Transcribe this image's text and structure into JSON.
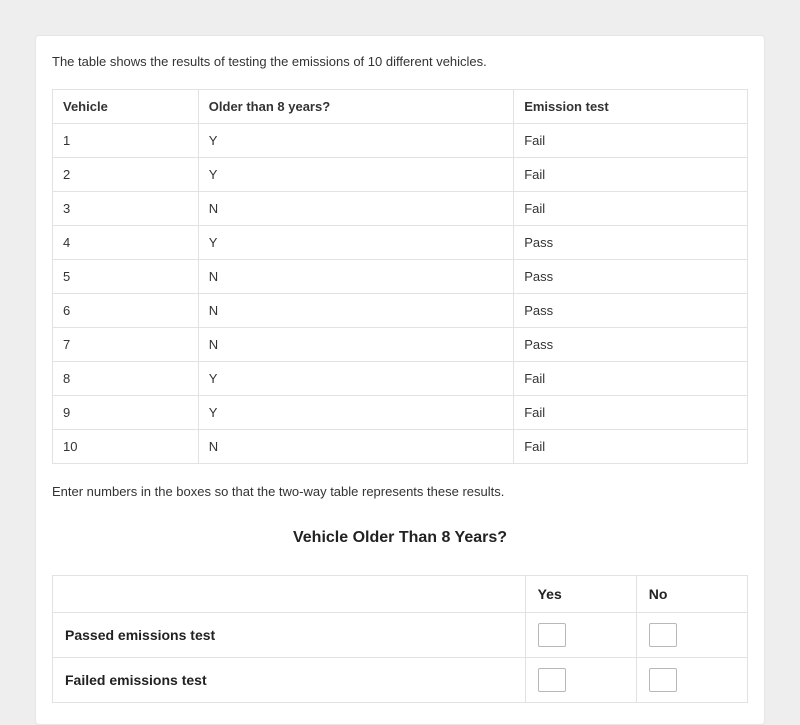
{
  "intro": "The table shows the results of testing the emissions of 10 different vehicles.",
  "dataTable": {
    "headers": [
      "Vehicle",
      "Older than 8 years?",
      "Emission test"
    ],
    "rows": [
      [
        "1",
        "Y",
        "Fail"
      ],
      [
        "2",
        "Y",
        "Fail"
      ],
      [
        "3",
        "N",
        "Fail"
      ],
      [
        "4",
        "Y",
        "Pass"
      ],
      [
        "5",
        "N",
        "Pass"
      ],
      [
        "6",
        "N",
        "Pass"
      ],
      [
        "7",
        "N",
        "Pass"
      ],
      [
        "8",
        "Y",
        "Fail"
      ],
      [
        "9",
        "Y",
        "Fail"
      ],
      [
        "10",
        "N",
        "Fail"
      ]
    ]
  },
  "instruction": "Enter numbers in the boxes so that the two-way table represents these results.",
  "twowayTitle": "Vehicle Older Than 8 Years?",
  "twoway": {
    "colHeaders": {
      "yes": "Yes",
      "no": "No"
    },
    "rows": {
      "passed": {
        "label": "Passed emissions test",
        "yes": "",
        "no": ""
      },
      "failed": {
        "label": "Failed emissions test",
        "yes": "",
        "no": ""
      }
    }
  }
}
